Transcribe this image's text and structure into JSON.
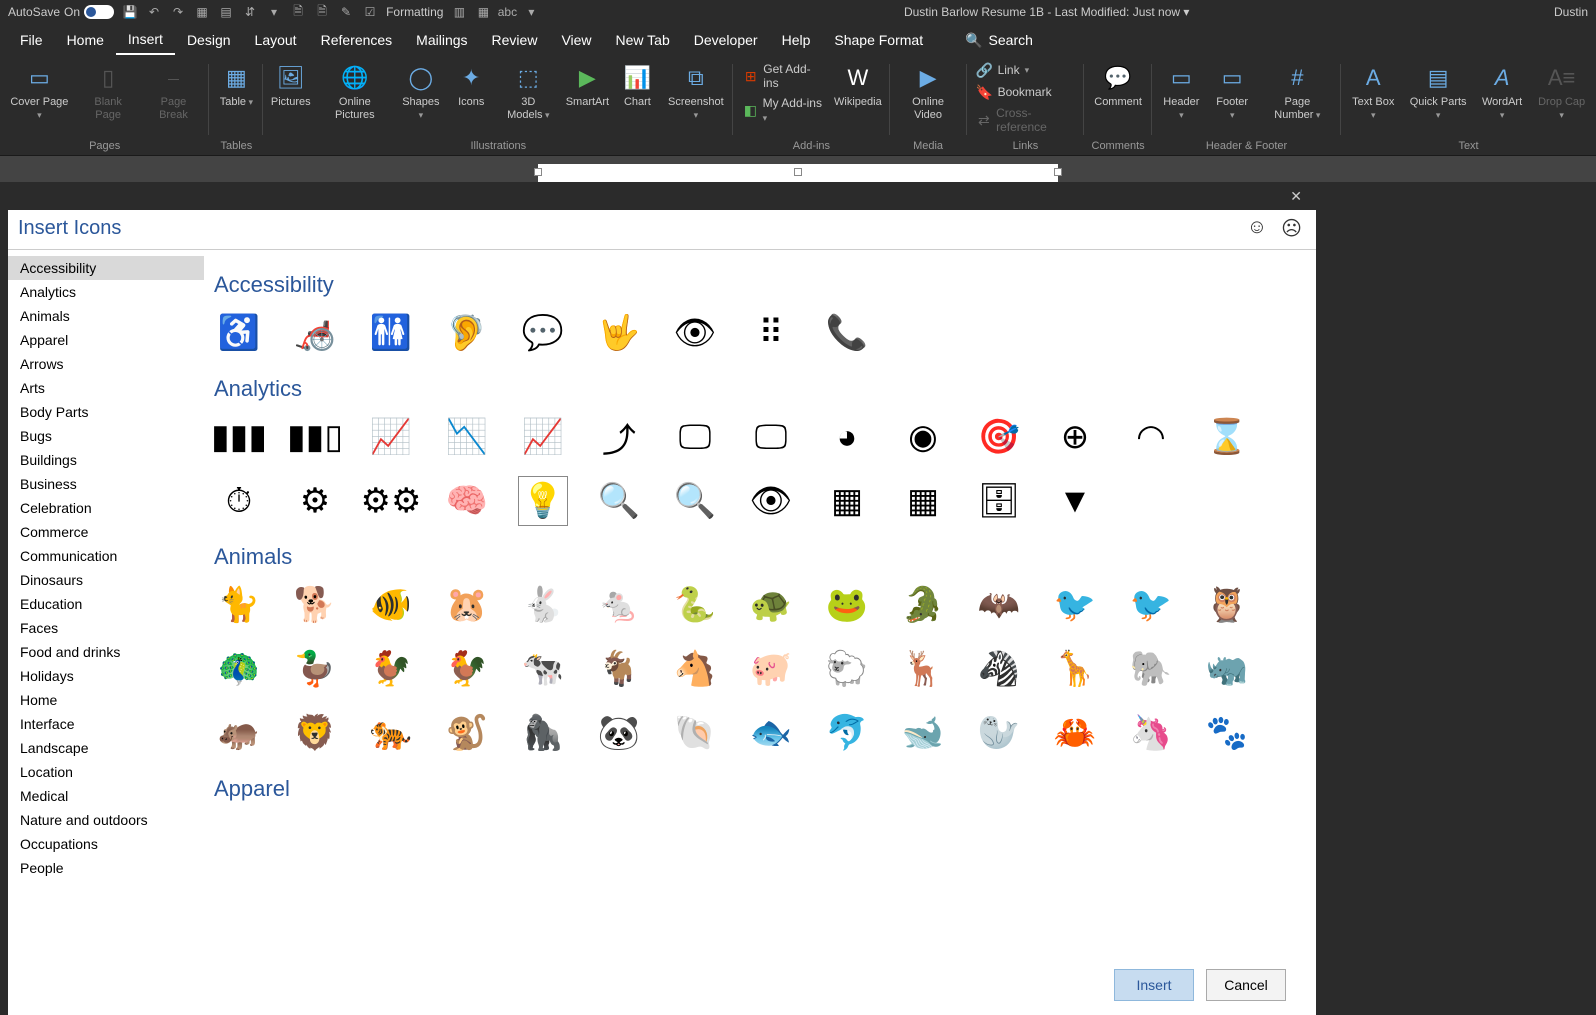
{
  "titlebar": {
    "autosave_label": "AutoSave",
    "autosave_state": "On",
    "doc_title": "Dustin Barlow Resume 1B  -  Last Modified: Just now ▾",
    "user": "Dustin",
    "formatting_label": "Formatting"
  },
  "menus": [
    "File",
    "Home",
    "Insert",
    "Design",
    "Layout",
    "References",
    "Mailings",
    "Review",
    "View",
    "New Tab",
    "Developer",
    "Help",
    "Shape Format"
  ],
  "menu_active_index": 2,
  "search_label": "Search",
  "ribbon": {
    "pages": {
      "label": "Pages",
      "cover_page": "Cover Page",
      "blank_page": "Blank Page",
      "page_break": "Page Break"
    },
    "tables": {
      "label": "Tables",
      "table": "Table"
    },
    "illustrations": {
      "label": "Illustrations",
      "pictures": "Pictures",
      "online_pictures": "Online Pictures",
      "shapes": "Shapes",
      "icons": "Icons",
      "models": "3D Models",
      "smartart": "SmartArt",
      "chart": "Chart",
      "screenshot": "Screenshot"
    },
    "addins": {
      "label": "Add-ins",
      "get_addins": "Get Add-ins",
      "my_addins": "My Add-ins",
      "wikipedia": "Wikipedia"
    },
    "media": {
      "label": "Media",
      "online_video": "Online Video"
    },
    "links": {
      "label": "Links",
      "link": "Link",
      "bookmark": "Bookmark",
      "cross_reference": "Cross-reference"
    },
    "comments": {
      "label": "Comments",
      "comment": "Comment"
    },
    "header_footer": {
      "label": "Header & Footer",
      "header": "Header",
      "footer": "Footer",
      "page_number": "Page Number"
    },
    "text": {
      "label": "Text",
      "text_box": "Text Box",
      "quick_parts": "Quick Parts",
      "wordart": "WordArt",
      "drop_cap": "Drop Cap"
    }
  },
  "dialog": {
    "title": "Insert Icons",
    "categories": [
      "Accessibility",
      "Analytics",
      "Animals",
      "Apparel",
      "Arrows",
      "Arts",
      "Body Parts",
      "Bugs",
      "Buildings",
      "Business",
      "Celebration",
      "Commerce",
      "Communication",
      "Dinosaurs",
      "Education",
      "Faces",
      "Food and drinks",
      "Holidays",
      "Home",
      "Interface",
      "Landscape",
      "Location",
      "Medical",
      "Nature and outdoors",
      "Occupations",
      "People"
    ],
    "active_category_index": 0,
    "sections": [
      {
        "title": "Accessibility",
        "icons": [
          "wheelchair-sign",
          "wheelchair-motion",
          "family-accessible",
          "deaf",
          "closed-caption",
          "sign-language",
          "low-vision",
          "braille",
          "tty"
        ]
      },
      {
        "title": "Analytics",
        "icons": [
          "bar-chart",
          "bar-chart-decline",
          "bar-chart-growth",
          "line-down",
          "line-up",
          "scatter-up",
          "presentation-bar",
          "presentation-pie",
          "pie-chart",
          "venn",
          "target",
          "crosshair",
          "gauge",
          "hourglass",
          "stopwatch",
          "gear",
          "gears",
          "brain-gear",
          "lightbulb",
          "magnifier",
          "pulse-magnifier",
          "eye",
          "strategy",
          "grid",
          "database",
          "funnel"
        ]
      },
      {
        "title": "Animals",
        "icons": [
          "cat",
          "dog",
          "fishbowl",
          "hamster",
          "rabbit",
          "mouse",
          "snake",
          "turtle",
          "frog",
          "crocodile",
          "bats",
          "bird",
          "hummingbird",
          "owl",
          "peacock",
          "duck",
          "chicken",
          "rooster",
          "cow",
          "goat",
          "donkey",
          "pig",
          "sheep",
          "deer",
          "zebra",
          "giraffe",
          "elephant",
          "rhino",
          "hippo",
          "lion",
          "tiger",
          "monkey",
          "gorilla",
          "panda",
          "shell",
          "fish",
          "dolphin",
          "whale",
          "seal",
          "crab",
          "unicorn",
          "pawprints"
        ]
      },
      {
        "title": "Apparel",
        "icons": []
      }
    ],
    "selected_icon": "lightbulb",
    "insert_label": "Insert",
    "cancel_label": "Cancel"
  }
}
